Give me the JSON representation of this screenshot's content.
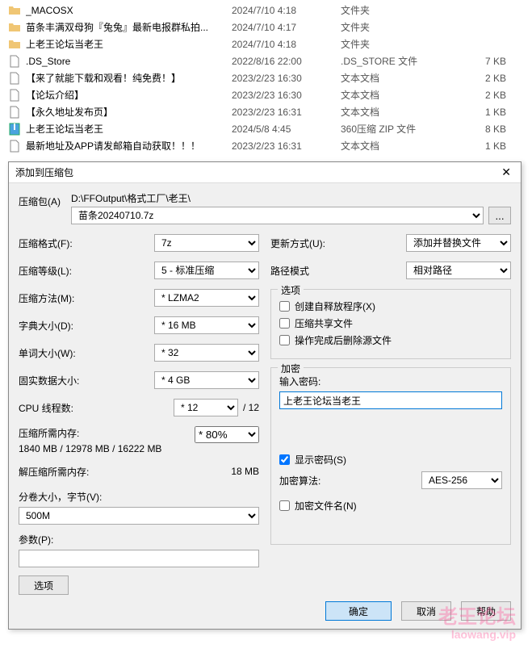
{
  "files": [
    {
      "icon": "folder",
      "name": "_MACOSX",
      "date": "2024/7/10 4:18",
      "type": "文件夹",
      "size": ""
    },
    {
      "icon": "folder",
      "name": "苗条丰满双母狗『兔兔』最新电报群私拍...",
      "date": "2024/7/10 4:17",
      "type": "文件夹",
      "size": ""
    },
    {
      "icon": "folder",
      "name": "上老王论坛当老王",
      "date": "2024/7/10 4:18",
      "type": "文件夹",
      "size": ""
    },
    {
      "icon": "file",
      "name": ".DS_Store",
      "date": "2022/8/16 22:00",
      "type": ".DS_STORE 文件",
      "size": "7 KB"
    },
    {
      "icon": "file",
      "name": "【来了就能下载和观看！纯免费！】",
      "date": "2023/2/23 16:30",
      "type": "文本文档",
      "size": "2 KB"
    },
    {
      "icon": "file",
      "name": "【论坛介绍】",
      "date": "2023/2/23 16:30",
      "type": "文本文档",
      "size": "2 KB"
    },
    {
      "icon": "file",
      "name": "【永久地址发布页】",
      "date": "2023/2/23 16:31",
      "type": "文本文档",
      "size": "1 KB"
    },
    {
      "icon": "zip",
      "name": "上老王论坛当老王",
      "date": "2024/5/8 4:45",
      "type": "360压缩 ZIP 文件",
      "size": "8 KB"
    },
    {
      "icon": "file",
      "name": "最新地址及APP请发邮箱自动获取！！！",
      "date": "2023/2/23 16:31",
      "type": "文本文档",
      "size": "1 KB"
    }
  ],
  "dialog": {
    "title": "添加到压缩包",
    "archive_label": "压缩包(A)",
    "archive_path": "D:\\FFOutput\\格式工厂\\老王\\",
    "archive_name": "苗条20240710.7z",
    "browse": "...",
    "left": {
      "format_label": "压缩格式(F):",
      "format_value": "7z",
      "level_label": "压缩等级(L):",
      "level_value": "5 - 标准压缩",
      "method_label": "压缩方法(M):",
      "method_value": "* LZMA2",
      "dict_label": "字典大小(D):",
      "dict_value": "* 16 MB",
      "word_label": "单词大小(W):",
      "word_value": "* 32",
      "solid_label": "固实数据大小:",
      "solid_value": "* 4 GB",
      "cpu_label": "CPU 线程数:",
      "cpu_value": "* 12",
      "cpu_suffix": "/ 12",
      "mem_comp_label": "压缩所需内存:",
      "mem_comp_value": "1840 MB / 12978 MB / 16222 MB",
      "mem_pct": "* 80%",
      "mem_decomp_label": "解压缩所需内存:",
      "mem_decomp_value": "18 MB",
      "split_label": "分卷大小，字节(V):",
      "split_value": "500M",
      "param_label": "参数(P):",
      "param_value": "",
      "options_btn": "选项"
    },
    "right": {
      "update_label": "更新方式(U):",
      "update_value": "添加并替换文件",
      "path_label": "路径模式",
      "path_value": "相对路径",
      "options_group": "选项",
      "opt_sfx": "创建自释放程序(X)",
      "opt_share": "压缩共享文件",
      "opt_delete": "操作完成后删除源文件",
      "encrypt_group": "加密",
      "pwd_label": "输入密码:",
      "pwd_value": "上老王论坛当老王",
      "show_pwd": "显示密码(S)",
      "algo_label": "加密算法:",
      "algo_value": "AES-256",
      "enc_names": "加密文件名(N)"
    },
    "buttons": {
      "ok": "确定",
      "cancel": "取消",
      "help": "帮助"
    }
  },
  "watermark": {
    "main": "老王论坛",
    "sub": "laowang.vip"
  }
}
